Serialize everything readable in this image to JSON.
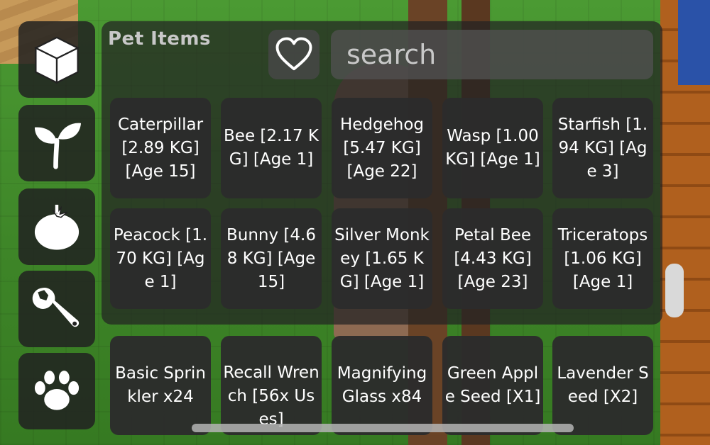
{
  "sidebar": {
    "items": [
      {
        "icon": "cube-icon"
      },
      {
        "icon": "sprout-icon"
      },
      {
        "icon": "tomato-icon"
      },
      {
        "icon": "wrench-icon"
      },
      {
        "icon": "paw-icon"
      }
    ]
  },
  "panel": {
    "title": "Pet Items",
    "favorite_icon": "heart-icon",
    "search_placeholder": "search"
  },
  "items": [
    "Caterpillar [2.89 KG] [Age 15]",
    "Bee [2.17 KG] [Age 1]",
    "Hedgehog [5.47 KG] [Age 22]",
    "Wasp [1.00 KG] [Age 1]",
    "Starfish [1.94 KG] [Age 3]",
    "Peacock [1.70 KG] [Age 1]",
    "Bunny [4.68 KG] [Age 15]",
    "Silver Monkey [1.65 KG] [Age 1]",
    "Petal Bee [4.43 KG] [Age 23]",
    "Triceratops [1.06 KG] [Age 1]",
    "Basic Sprinkler x24",
    "Recall Wrench [56x Uses]",
    "Magnifying Glass x84",
    "Green Apple Seed [X1]",
    "Lavender Seed [X2]"
  ],
  "colors": {
    "panel": "#232323",
    "tile": "#2c2c2c",
    "grass": "#3f8a2c"
  }
}
